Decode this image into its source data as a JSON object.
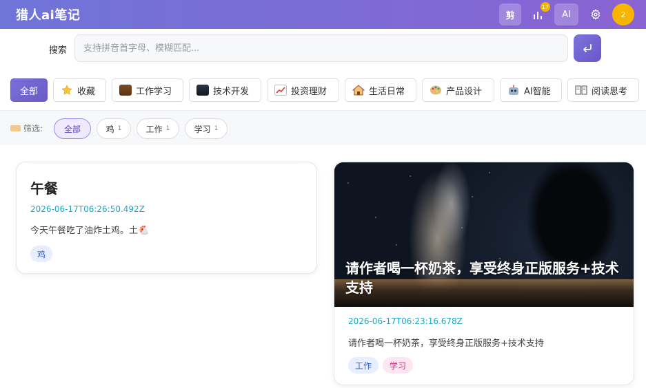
{
  "app": {
    "title": "猎人ai笔记"
  },
  "header": {
    "clip_label": "剪",
    "stats_badge": "17",
    "ai_label": "AI",
    "avatar_count": "2"
  },
  "search": {
    "label": "搜索",
    "placeholder": "支持拼音首字母、模糊匹配...",
    "value": ""
  },
  "categories": [
    {
      "label": "全部",
      "icon": "",
      "active": true
    },
    {
      "label": "收藏",
      "icon": "star-icon"
    },
    {
      "label": "工作学习",
      "icon": "briefcase-icon"
    },
    {
      "label": "技术开发",
      "icon": "laptop-icon"
    },
    {
      "label": "投资理财",
      "icon": "chart-up-icon"
    },
    {
      "label": "生活日常",
      "icon": "house-icon"
    },
    {
      "label": "产品设计",
      "icon": "palette-icon"
    },
    {
      "label": "AI智能",
      "icon": "robot-icon"
    },
    {
      "label": "阅读思考",
      "icon": "book-icon"
    }
  ],
  "filter": {
    "label": "筛选:",
    "chips": [
      {
        "label": "全部",
        "count": "",
        "active": true
      },
      {
        "label": "鸡",
        "count": "1"
      },
      {
        "label": "工作",
        "count": "1"
      },
      {
        "label": "学习",
        "count": "1"
      }
    ]
  },
  "notes": [
    {
      "title": "午餐",
      "date": "2026-06-17T06:26:50.492Z",
      "body": "今天午餐吃了油炸土鸡。土🐔",
      "tags": [
        "鸡"
      ]
    },
    {
      "image_caption": "请作者喝一杯奶茶，享受终身正版服务+技术支持",
      "date": "2026-06-17T06:23:16.678Z",
      "body": "请作者喝一杯奶茶，享受终身正版服务+技术支持",
      "tags": [
        "工作",
        "学习"
      ]
    }
  ],
  "colors": {
    "header_gradient_start": "#6f74d8",
    "header_gradient_end": "#8a63d2",
    "accent": "#6a5bc8",
    "date": "#18a8c8",
    "avatar": "#f8b500"
  }
}
